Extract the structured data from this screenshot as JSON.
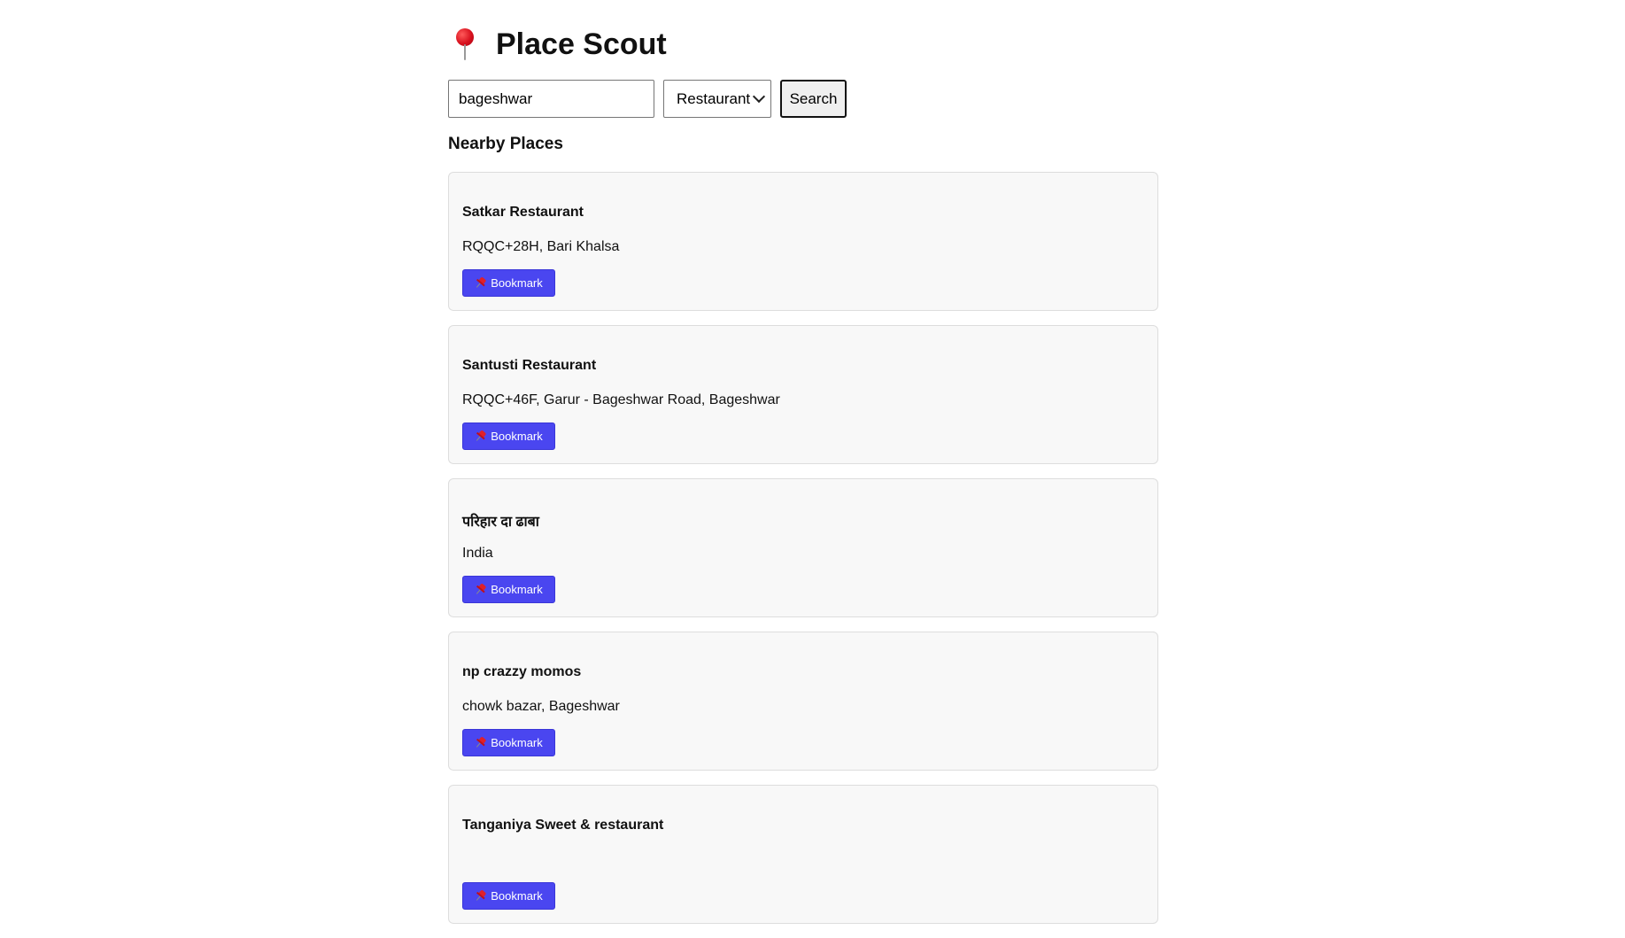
{
  "app": {
    "title": "Place Scout",
    "title_icon": "round-pushpin-icon"
  },
  "search": {
    "query": "bageshwar",
    "category_selected": "Restaurant",
    "button_label": "Search"
  },
  "results_heading": "Nearby Places",
  "places": [
    {
      "name": "Satkar Restaurant",
      "address": "RQQC+28H, Bari Khalsa",
      "bookmark_label": "Bookmark"
    },
    {
      "name": "Santusti Restaurant",
      "address": "RQQC+46F, Garur - Bageshwar Road, Bageshwar",
      "bookmark_label": "Bookmark"
    },
    {
      "name": "परिहार दा ढाबा",
      "address": "India",
      "bookmark_label": "Bookmark"
    },
    {
      "name": "np crazzy momos",
      "address": "chowk bazar, Bageshwar",
      "bookmark_label": "Bookmark"
    },
    {
      "name": "Tanganiya Sweet & restaurant",
      "address": "",
      "bookmark_label": "Bookmark"
    }
  ],
  "colors": {
    "bookmark_button": "#4a46f0",
    "card_background": "#f8f8f8",
    "card_border": "#dddddd"
  }
}
